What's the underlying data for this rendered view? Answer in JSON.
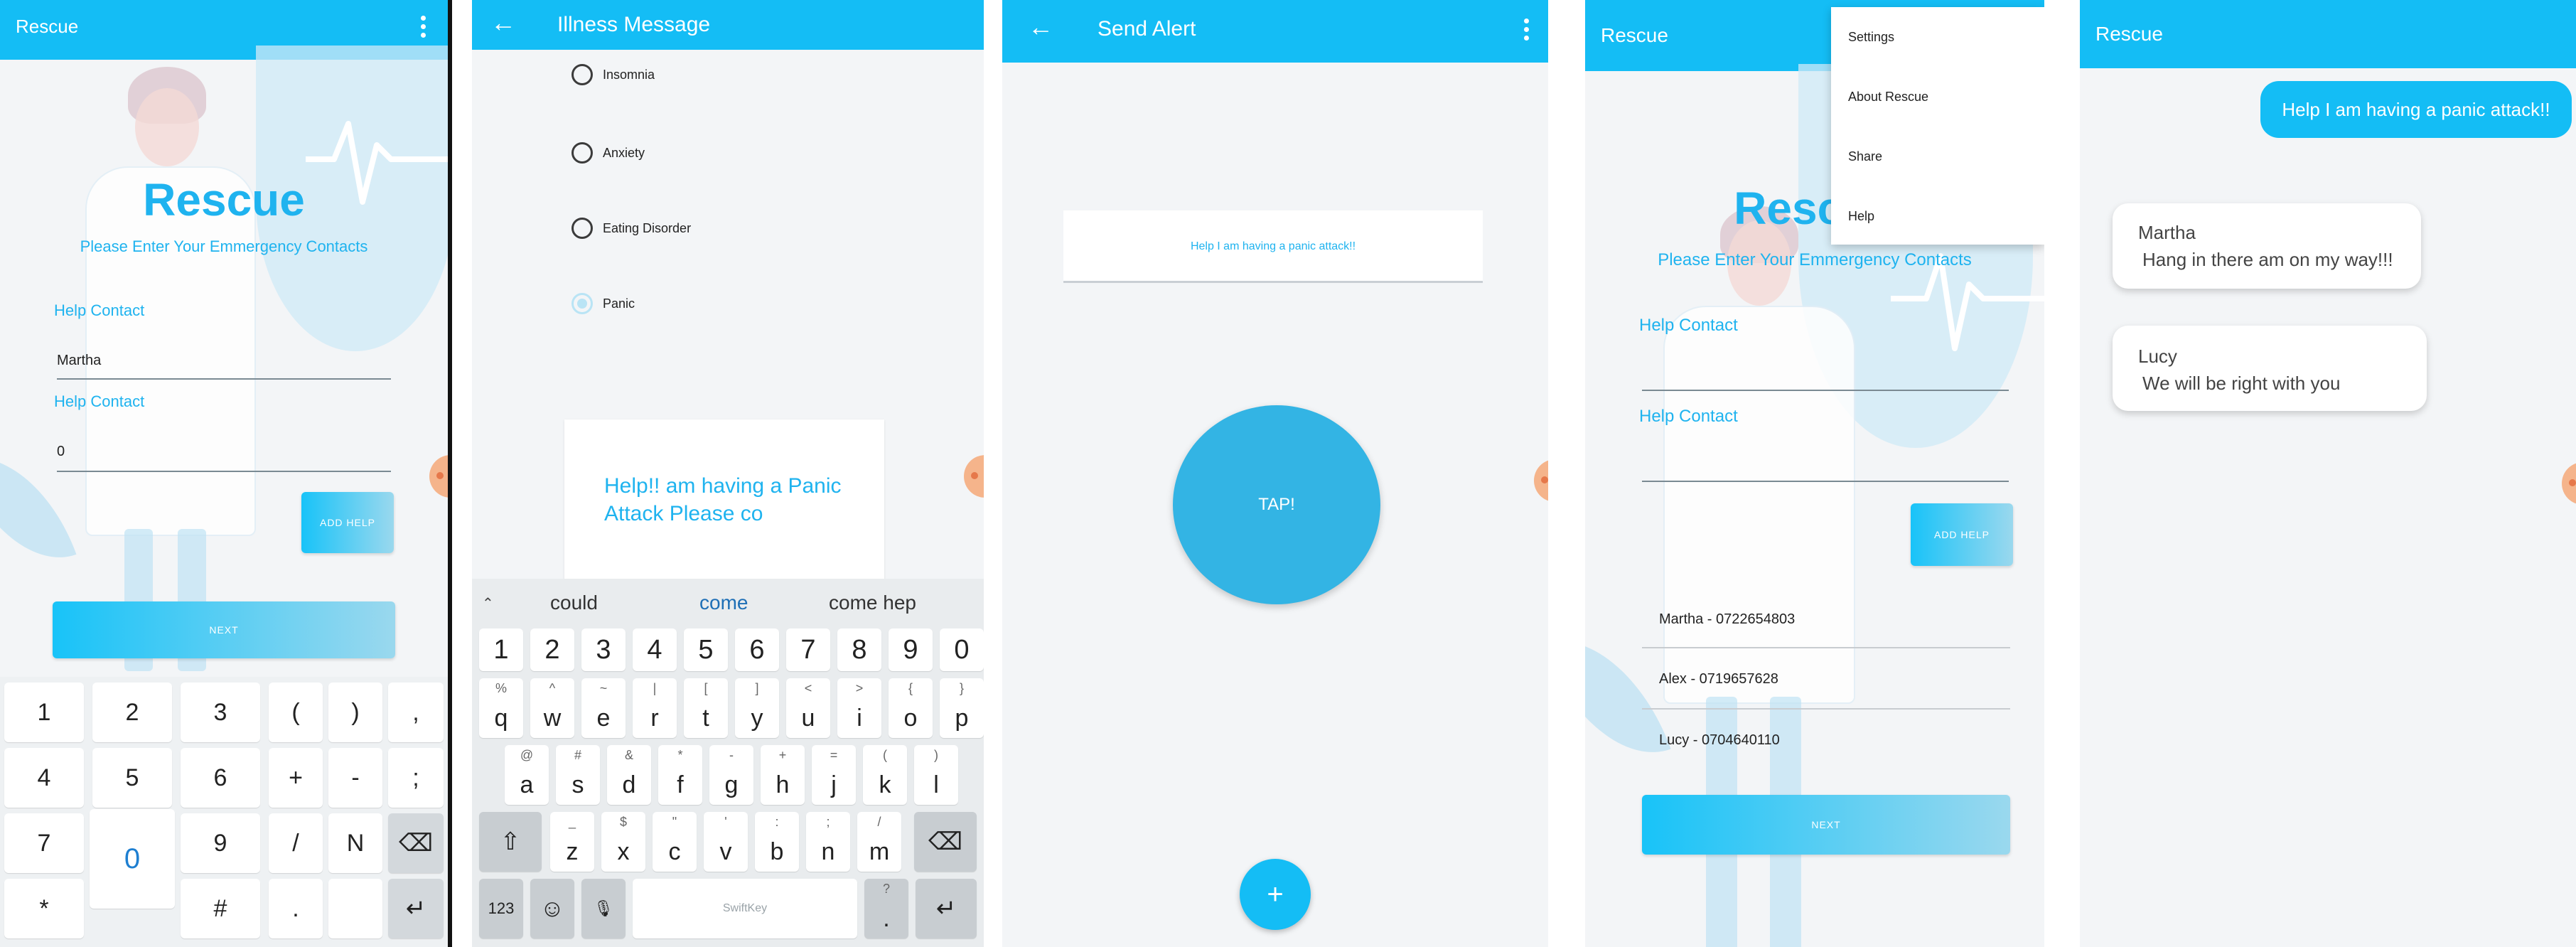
{
  "screen1": {
    "app_title": "Rescue",
    "heading": "Rescue",
    "subheading": "Please Enter Your Emmergency Contacts",
    "field1_label": "Help Contact",
    "field1_value": "Martha",
    "field2_label": "Help Contact",
    "field2_value": "0",
    "add_help_label": "ADD HELP",
    "next_label": "NEXT",
    "keys": [
      [
        "1",
        "2",
        "3",
        "(",
        ")",
        ","
      ],
      [
        "4",
        "5",
        "6",
        "+",
        "-",
        ";"
      ],
      [
        "7",
        "0",
        "9",
        "/",
        "N",
        "⌫"
      ],
      [
        "*",
        "",
        "#",
        ".",
        "",
        "↵"
      ]
    ]
  },
  "screen2": {
    "app_title": "Illness Message",
    "options": [
      {
        "label": "Insomnia",
        "checked": false
      },
      {
        "label": "Anxiety",
        "checked": false
      },
      {
        "label": "Eating Disorder",
        "checked": false
      },
      {
        "label": "Panic",
        "checked": true
      }
    ],
    "message_text": "Help!! am having a Panic Attack Please co",
    "suggestions": [
      "could",
      "come",
      "come hep"
    ],
    "number_row": [
      "1",
      "2",
      "3",
      "4",
      "5",
      "6",
      "7",
      "8",
      "9",
      "0"
    ],
    "row1": [
      {
        "key": "q",
        "sub": "%"
      },
      {
        "key": "w",
        "sub": "^"
      },
      {
        "key": "e",
        "sub": "~"
      },
      {
        "key": "r",
        "sub": "|"
      },
      {
        "key": "t",
        "sub": "["
      },
      {
        "key": "y",
        "sub": "]"
      },
      {
        "key": "u",
        "sub": "<"
      },
      {
        "key": "i",
        "sub": ">"
      },
      {
        "key": "o",
        "sub": "{"
      },
      {
        "key": "p",
        "sub": "}"
      }
    ],
    "row2": [
      {
        "key": "a",
        "sub": "@"
      },
      {
        "key": "s",
        "sub": "#"
      },
      {
        "key": "d",
        "sub": "&"
      },
      {
        "key": "f",
        "sub": "*"
      },
      {
        "key": "g",
        "sub": "-"
      },
      {
        "key": "h",
        "sub": "+"
      },
      {
        "key": "j",
        "sub": "="
      },
      {
        "key": "k",
        "sub": "("
      },
      {
        "key": "l",
        "sub": ")"
      }
    ],
    "row3": [
      {
        "key": "z",
        "sub": "_"
      },
      {
        "key": "x",
        "sub": "$"
      },
      {
        "key": "c",
        "sub": "\""
      },
      {
        "key": "v",
        "sub": "'"
      },
      {
        "key": "b",
        "sub": ":"
      },
      {
        "key": "n",
        "sub": ";"
      },
      {
        "key": "m",
        "sub": "/"
      }
    ],
    "bottom_123": "123",
    "space_label": "SwiftKey",
    "comma_sub": "?"
  },
  "screen3": {
    "app_title": "Send Alert",
    "alert_text": "Help I am having a panic attack!!",
    "tap_label": "TAP!",
    "fab_label": "+"
  },
  "screen4": {
    "app_title": "Rescue",
    "heading": "Rescue",
    "subheading": "Please Enter Your Emmergency Contacts",
    "field1_label": "Help Contact",
    "field2_label": "Help Contact",
    "add_help_label": "ADD HELP",
    "menu": [
      "Settings",
      "About Rescue",
      "Share",
      "Help"
    ],
    "contacts": [
      "Martha - 0722654803",
      "Alex - 0719657628",
      "Lucy - 0704640110"
    ],
    "next_label": "NEXT"
  },
  "screen5": {
    "app_title": "Rescue",
    "my_message": "Help I am having a panic attack!!",
    "replies": [
      {
        "name": "Martha",
        "text": "Hang in there am on my way!!!"
      },
      {
        "name": "Lucy",
        "text": "We will be right with you"
      }
    ]
  },
  "colors": {
    "primary": "#14bdf5",
    "accent_text": "#1fb3ef",
    "tap_button": "#33b4e4"
  }
}
